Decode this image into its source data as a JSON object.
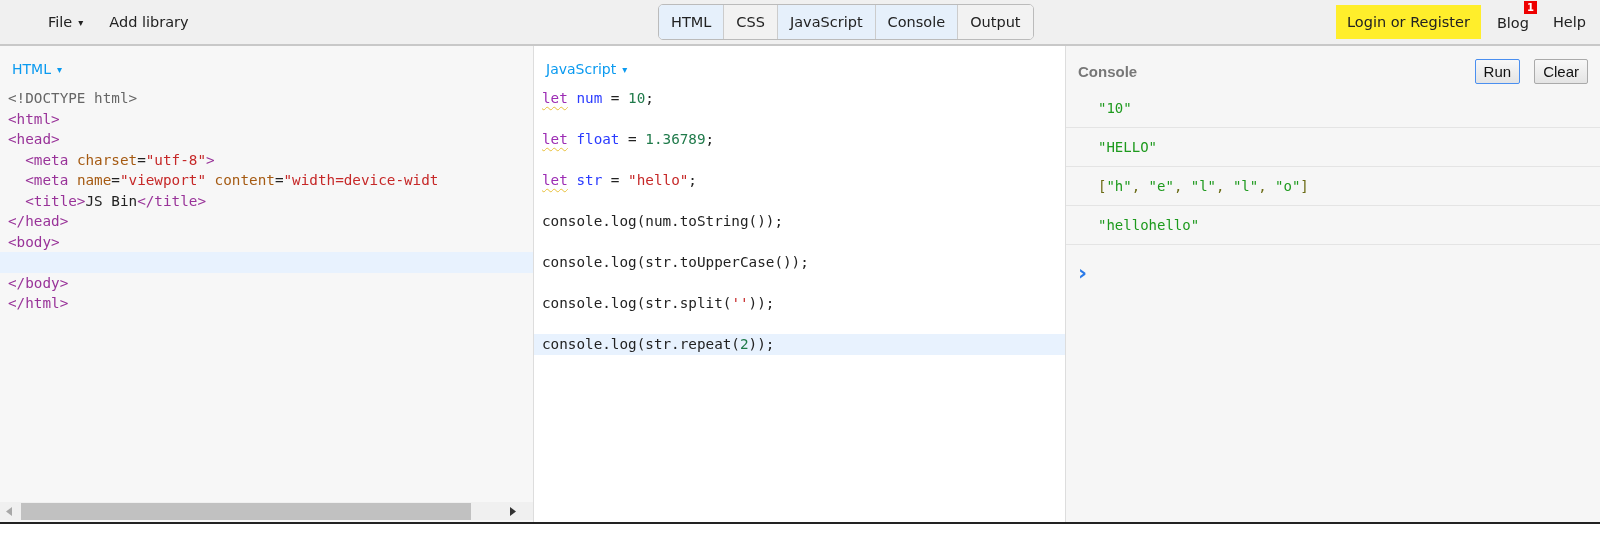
{
  "menu": [
    {
      "label": "File",
      "caret": "▾"
    },
    {
      "label": "Add library"
    }
  ],
  "view_tabs": [
    {
      "label": "HTML",
      "selected": true
    },
    {
      "label": "CSS",
      "selected": false
    },
    {
      "label": "JavaScript",
      "selected": true
    },
    {
      "label": "Console",
      "selected": true
    },
    {
      "label": "Output",
      "selected": false
    }
  ],
  "login_button": "Login or Register",
  "blog": {
    "label": "Blog",
    "badge": "1"
  },
  "help": "Help",
  "html_panel": {
    "title": "HTML",
    "caret": "▾",
    "lines": [
      {
        "kind": "code",
        "selected": false,
        "tokens": [
          {
            "kind": "meta",
            "s": "<!DOCTYPE html>"
          }
        ]
      },
      {
        "kind": "code",
        "selected": false,
        "tokens": [
          {
            "kind": "tag",
            "s": "<html>"
          }
        ]
      },
      {
        "kind": "code",
        "selected": false,
        "tokens": [
          {
            "kind": "tag",
            "s": "<head>"
          }
        ]
      },
      {
        "kind": "code",
        "selected": false,
        "tokens": [
          {
            "kind": "tag",
            "s": "  <meta "
          },
          {
            "kind": "attr",
            "s": "charset"
          },
          {
            "kind": "plain",
            "s": "="
          },
          {
            "kind": "string",
            "s": "\"utf-8\""
          },
          {
            "kind": "tag",
            "s": ">"
          }
        ]
      },
      {
        "kind": "code",
        "selected": false,
        "tokens": [
          {
            "kind": "tag",
            "s": "  <meta "
          },
          {
            "kind": "attr",
            "s": "name"
          },
          {
            "kind": "plain",
            "s": "="
          },
          {
            "kind": "string",
            "s": "\"viewport\" "
          },
          {
            "kind": "attr",
            "s": "content"
          },
          {
            "kind": "plain",
            "s": "="
          },
          {
            "kind": "string",
            "s": "\"width=device-widt"
          }
        ]
      },
      {
        "kind": "code",
        "selected": false,
        "tokens": [
          {
            "kind": "tag",
            "s": "  <title>"
          },
          {
            "kind": "plain",
            "s": "JS Bin"
          },
          {
            "kind": "tag",
            "s": "</title>"
          }
        ]
      },
      {
        "kind": "code",
        "selected": false,
        "tokens": [
          {
            "kind": "tag",
            "s": "</head>"
          }
        ]
      },
      {
        "kind": "code",
        "selected": false,
        "tokens": [
          {
            "kind": "tag",
            "s": "<body>"
          }
        ]
      },
      {
        "kind": "blank",
        "selected": true
      },
      {
        "kind": "code",
        "selected": false,
        "tokens": [
          {
            "kind": "tag",
            "s": "</body>"
          }
        ]
      },
      {
        "kind": "code",
        "selected": false,
        "tokens": [
          {
            "kind": "tag",
            "s": "</html>"
          }
        ]
      }
    ]
  },
  "js_panel": {
    "title": "JavaScript",
    "caret": "▾",
    "lines": [
      {
        "kind": "code",
        "selected": false,
        "warning": true,
        "tokens": [
          {
            "kind": "keyword",
            "s": "let"
          },
          {
            "kind": "def",
            "s": " num"
          },
          {
            "kind": "plain",
            "s": " = "
          },
          {
            "kind": "number",
            "s": "10"
          },
          {
            "kind": "plain",
            "s": ";"
          }
        ]
      },
      {
        "kind": "code",
        "selected": false,
        "warning": true,
        "tokens": [
          {
            "kind": "keyword",
            "s": "let"
          },
          {
            "kind": "def",
            "s": " float"
          },
          {
            "kind": "plain",
            "s": " = "
          },
          {
            "kind": "number",
            "s": "1.36789"
          },
          {
            "kind": "plain",
            "s": ";"
          }
        ]
      },
      {
        "kind": "code",
        "selected": false,
        "warning": true,
        "tokens": [
          {
            "kind": "keyword",
            "s": "let"
          },
          {
            "kind": "def",
            "s": " str"
          },
          {
            "kind": "plain",
            "s": " = "
          },
          {
            "kind": "string",
            "s": "\"hello\""
          },
          {
            "kind": "plain",
            "s": ";"
          }
        ]
      },
      {
        "kind": "code",
        "selected": false,
        "warning": false,
        "tokens": [
          {
            "kind": "plain",
            "s": "console.log(num.toString());"
          }
        ]
      },
      {
        "kind": "code",
        "selected": false,
        "warning": false,
        "tokens": [
          {
            "kind": "plain",
            "s": "console.log(str.toUpperCase());"
          }
        ]
      },
      {
        "kind": "code",
        "selected": false,
        "warning": false,
        "tokens": [
          {
            "kind": "plain",
            "s": "console.log(str.split("
          },
          {
            "kind": "string",
            "s": "''"
          },
          {
            "kind": "plain",
            "s": "));"
          }
        ]
      },
      {
        "kind": "code",
        "selected": true,
        "warning": false,
        "tokens": [
          {
            "kind": "plain",
            "s": "console.log(str.repeat("
          },
          {
            "kind": "number",
            "s": "2"
          },
          {
            "kind": "plain",
            "s": "));"
          }
        ]
      }
    ]
  },
  "console_panel": {
    "title": "Console",
    "run_button": "Run",
    "clear_button": "Clear",
    "prompt": "›",
    "outputs": [
      {
        "tokens": [
          {
            "kind": "string",
            "s": "\"10\""
          }
        ]
      },
      {
        "tokens": [
          {
            "kind": "string",
            "s": "\"HELLO\""
          }
        ]
      },
      {
        "tokens": [
          {
            "kind": "punct",
            "s": "["
          },
          {
            "kind": "string",
            "s": "\"h\""
          },
          {
            "kind": "punct",
            "s": ", "
          },
          {
            "kind": "string",
            "s": "\"e\""
          },
          {
            "kind": "punct",
            "s": ", "
          },
          {
            "kind": "string",
            "s": "\"l\""
          },
          {
            "kind": "punct",
            "s": ", "
          },
          {
            "kind": "string",
            "s": "\"l\""
          },
          {
            "kind": "punct",
            "s": ", "
          },
          {
            "kind": "string",
            "s": "\"o\""
          },
          {
            "kind": "punct",
            "s": "]"
          }
        ]
      },
      {
        "tokens": [
          {
            "kind": "string",
            "s": "\"hellohello\""
          }
        ]
      }
    ]
  }
}
